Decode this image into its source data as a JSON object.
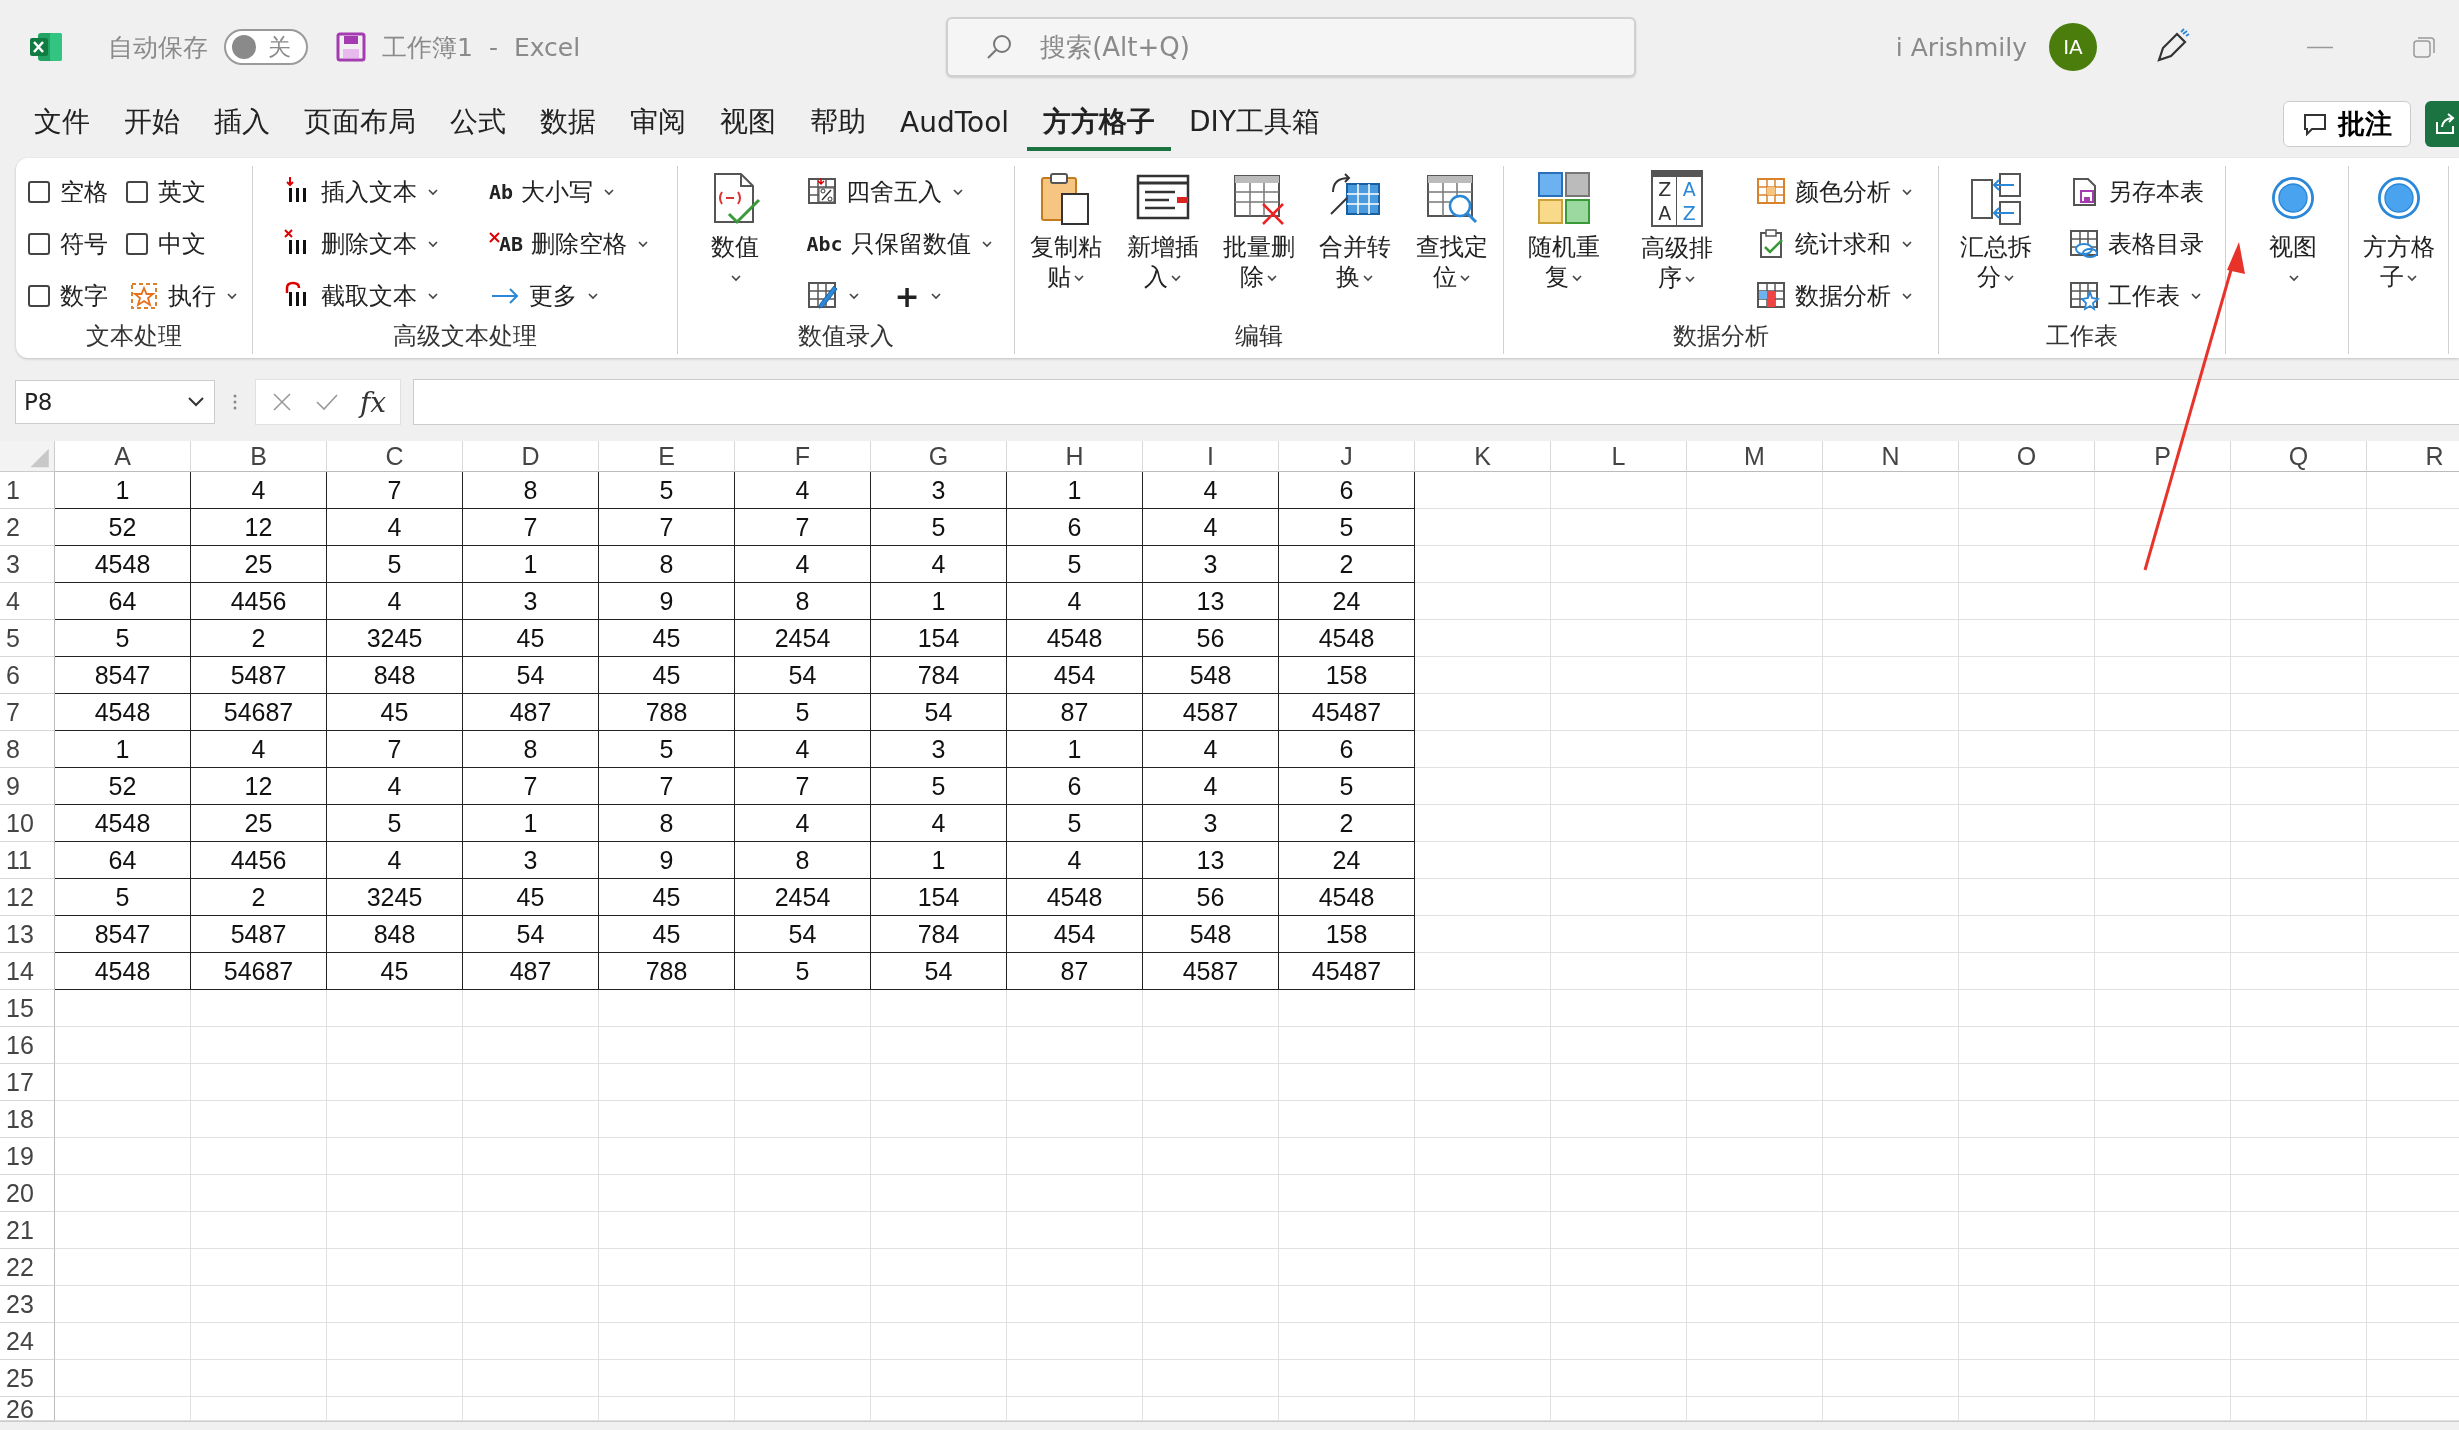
{
  "title_bar": {
    "autosave_label": "自动保存",
    "autosave_on": false,
    "autosave_state": "关",
    "document_title": "工作簿1",
    "separator": "-",
    "app_name": "Excel",
    "search_placeholder": "搜索(Alt+Q)",
    "user_name": "i Arishmily",
    "avatar_initials": "IA"
  },
  "menu_tabs": [
    {
      "label": "文件",
      "selected": false
    },
    {
      "label": "开始",
      "selected": false
    },
    {
      "label": "插入",
      "selected": false
    },
    {
      "label": "页面布局",
      "selected": false
    },
    {
      "label": "公式",
      "selected": false
    },
    {
      "label": "数据",
      "selected": false
    },
    {
      "label": "审阅",
      "selected": false
    },
    {
      "label": "视图",
      "selected": false
    },
    {
      "label": "帮助",
      "selected": false
    },
    {
      "label": "AudTool",
      "selected": false
    },
    {
      "label": "方方格子",
      "selected": true
    },
    {
      "label": "DIY工具箱",
      "selected": false
    }
  ],
  "comment_button": "批注",
  "ribbon_groups": [
    {
      "label": "文本处理",
      "columns": [
        [
          {
            "kind": "checkbox",
            "label": "空格",
            "checked": false
          },
          {
            "kind": "checkbox",
            "label": "符号",
            "checked": false
          },
          {
            "kind": "checkbox",
            "label": "数字",
            "checked": false
          }
        ],
        [
          {
            "kind": "checkbox",
            "label": "英文",
            "checked": false
          },
          {
            "kind": "checkbox",
            "label": "中文",
            "checked": false
          },
          {
            "kind": "small",
            "label": "执行",
            "dropdown": true
          }
        ]
      ]
    },
    {
      "label": "高级文本处理",
      "columns": [
        [
          {
            "kind": "small",
            "label": "插入文本",
            "dropdown": true
          },
          {
            "kind": "small",
            "label": "删除文本",
            "dropdown": true
          },
          {
            "kind": "small",
            "label": "截取文本",
            "dropdown": true
          }
        ],
        [
          {
            "kind": "small",
            "label": "大小写",
            "dropdown": true,
            "icon_text": [
              "Ab"
            ]
          },
          {
            "kind": "small",
            "label": "删除空格",
            "dropdown": true,
            "icon_text": [
              "AB"
            ]
          },
          {
            "kind": "small",
            "label": "更多",
            "dropdown": true
          }
        ]
      ]
    },
    {
      "label": "数值录入",
      "columns": [
        [
          {
            "kind": "large",
            "label": "数值",
            "dropdown": true
          }
        ],
        [
          {
            "kind": "small",
            "label": "四舍五入",
            "dropdown": true
          },
          {
            "kind": "small",
            "label": "只保留数值",
            "dropdown": true,
            "icon_text": [
              "Abc"
            ]
          },
          {
            "kind": "row",
            "items": [
              {
                "kind": "small",
                "dropdown": true
              },
              {
                "kind": "glyph",
                "glyph": "+",
                "dropdown": true
              }
            ]
          }
        ]
      ]
    },
    {
      "label": "编辑",
      "columns": [
        [
          {
            "kind": "large",
            "label": "复制粘贴",
            "dropdown": true
          }
        ],
        [
          {
            "kind": "large",
            "label": "新增插入",
            "dropdown": true
          }
        ],
        [
          {
            "kind": "large",
            "label": "批量删除",
            "dropdown": true
          }
        ],
        [
          {
            "kind": "large",
            "label": "合并转换",
            "dropdown": true
          }
        ],
        [
          {
            "kind": "large",
            "label": "查找定位",
            "dropdown": true
          }
        ]
      ]
    },
    {
      "label": "数据分析",
      "columns": [
        [
          {
            "kind": "large",
            "label": "随机重复",
            "dropdown": true
          }
        ],
        [
          {
            "kind": "large",
            "label": "高级排序",
            "dropdown": true,
            "icon_text": [
              "Z",
              "A",
              "A",
              "Z"
            ]
          }
        ],
        [
          {
            "kind": "small",
            "label": "颜色分析",
            "dropdown": true
          },
          {
            "kind": "small",
            "label": "统计求和",
            "dropdown": true
          },
          {
            "kind": "small",
            "label": "数据分析",
            "dropdown": true
          }
        ]
      ]
    },
    {
      "label": "工作表",
      "columns": [
        [
          {
            "kind": "large",
            "label": "汇总拆分",
            "dropdown": true
          }
        ],
        [
          {
            "kind": "small",
            "label": "另存本表",
            "dropdown": false
          },
          {
            "kind": "small",
            "label": "表格目录",
            "dropdown": false
          },
          {
            "kind": "small",
            "label": "工作表",
            "dropdown": true
          }
        ]
      ]
    },
    {
      "columns": [
        [
          {
            "kind": "large",
            "label": "视图",
            "dropdown": true
          }
        ]
      ]
    },
    {
      "columns": [
        [
          {
            "kind": "large",
            "label": "方方格子",
            "dropdown": true
          }
        ]
      ]
    }
  ],
  "formula_bar": {
    "name_box": "P8",
    "function_label": "fx"
  },
  "sheet": {
    "columns": [
      "A",
      "B",
      "C",
      "D",
      "E",
      "F",
      "G",
      "H",
      "I",
      "J",
      "K",
      "L",
      "M",
      "N",
      "O",
      "P",
      "Q",
      "R"
    ],
    "rows": [
      {
        "number": "1",
        "cells": [
          "1",
          "4",
          "7",
          "8",
          "5",
          "4",
          "3",
          "1",
          "4",
          "6"
        ]
      },
      {
        "number": "2",
        "cells": [
          "52",
          "12",
          "4",
          "7",
          "7",
          "7",
          "5",
          "6",
          "4",
          "5"
        ]
      },
      {
        "number": "3",
        "cells": [
          "4548",
          "25",
          "5",
          "1",
          "8",
          "4",
          "4",
          "5",
          "3",
          "2"
        ]
      },
      {
        "number": "4",
        "cells": [
          "64",
          "4456",
          "4",
          "3",
          "9",
          "8",
          "1",
          "4",
          "13",
          "24"
        ]
      },
      {
        "number": "5",
        "cells": [
          "5",
          "2",
          "3245",
          "45",
          "45",
          "2454",
          "154",
          "4548",
          "56",
          "4548"
        ]
      },
      {
        "number": "6",
        "cells": [
          "8547",
          "5487",
          "848",
          "54",
          "45",
          "54",
          "784",
          "454",
          "548",
          "158"
        ]
      },
      {
        "number": "7",
        "cells": [
          "4548",
          "54687",
          "45",
          "487",
          "788",
          "5",
          "54",
          "87",
          "4587",
          "45487"
        ]
      },
      {
        "number": "8",
        "cells": [
          "1",
          "4",
          "7",
          "8",
          "5",
          "4",
          "3",
          "1",
          "4",
          "6"
        ]
      },
      {
        "number": "9",
        "cells": [
          "52",
          "12",
          "4",
          "7",
          "7",
          "7",
          "5",
          "6",
          "4",
          "5"
        ]
      },
      {
        "number": "10",
        "cells": [
          "4548",
          "25",
          "5",
          "1",
          "8",
          "4",
          "4",
          "5",
          "3",
          "2"
        ]
      },
      {
        "number": "11",
        "cells": [
          "64",
          "4456",
          "4",
          "3",
          "9",
          "8",
          "1",
          "4",
          "13",
          "24"
        ]
      },
      {
        "number": "12",
        "cells": [
          "5",
          "2",
          "3245",
          "45",
          "45",
          "2454",
          "154",
          "4548",
          "56",
          "4548"
        ]
      },
      {
        "number": "13",
        "cells": [
          "8547",
          "5487",
          "848",
          "54",
          "45",
          "54",
          "784",
          "454",
          "548",
          "158"
        ]
      },
      {
        "number": "14",
        "cells": [
          "4548",
          "54687",
          "45",
          "487",
          "788",
          "5",
          "54",
          "87",
          "4587",
          "45487"
        ]
      },
      {
        "number": "15"
      },
      {
        "number": "16"
      },
      {
        "number": "17"
      },
      {
        "number": "18"
      },
      {
        "number": "19"
      },
      {
        "number": "20"
      },
      {
        "number": "21"
      },
      {
        "number": "22"
      },
      {
        "number": "23"
      },
      {
        "number": "24"
      },
      {
        "number": "25"
      },
      {
        "number": "26"
      }
    ]
  }
}
